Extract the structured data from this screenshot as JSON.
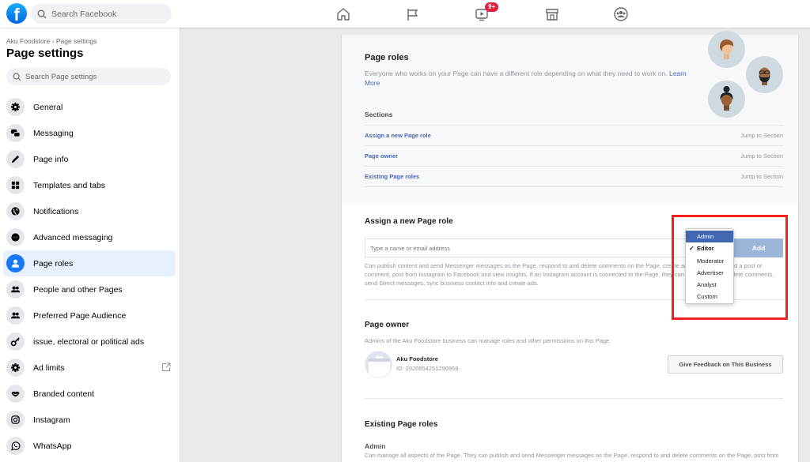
{
  "topbar": {
    "logo": "f",
    "search_placeholder": "Search Facebook",
    "nav": [
      {
        "name": "home",
        "icon": "home-icon"
      },
      {
        "name": "pages",
        "icon": "flag-icon"
      },
      {
        "name": "watch",
        "icon": "video-icon",
        "badge": "9+"
      },
      {
        "name": "marketplace",
        "icon": "store-icon"
      },
      {
        "name": "groups",
        "icon": "groups-icon"
      }
    ]
  },
  "sidebar": {
    "breadcrumb": "Aku Foodstore › Page settings",
    "title": "Page settings",
    "search_placeholder": "Search Page settings",
    "items": [
      {
        "label": "General",
        "icon": "gear-icon"
      },
      {
        "label": "Messaging",
        "icon": "chat-bubbles-icon"
      },
      {
        "label": "Page info",
        "icon": "pencil-icon"
      },
      {
        "label": "Templates and tabs",
        "icon": "grid-icon"
      },
      {
        "label": "Notifications",
        "icon": "globe-icon"
      },
      {
        "label": "Advanced messaging",
        "icon": "messenger-icon"
      },
      {
        "label": "Page roles",
        "icon": "person-icon",
        "active": true
      },
      {
        "label": "People and other Pages",
        "icon": "people-icon"
      },
      {
        "label": "Preferred Page Audience",
        "icon": "people-icon"
      },
      {
        "label": "issue, electoral or political ads",
        "icon": "key-icon"
      },
      {
        "label": "Ad limits",
        "icon": "gear-icon",
        "external": true
      },
      {
        "label": "Branded content",
        "icon": "handshake-icon"
      },
      {
        "label": "Instagram",
        "icon": "instagram-icon"
      },
      {
        "label": "WhatsApp",
        "icon": "whatsapp-icon"
      }
    ]
  },
  "main": {
    "intro": {
      "title": "Page roles",
      "description": "Everyone who works on your Page can have a different role depending on what they need to work on.",
      "learn_more": "Learn More",
      "sections_heading": "Sections",
      "sections": [
        {
          "label": "Assign a new Page role",
          "jump": "Jump to Section"
        },
        {
          "label": "Page owner",
          "jump": "Jump to Section"
        },
        {
          "label": "Existing Page roles",
          "jump": "Jump to Section"
        }
      ]
    },
    "assign": {
      "title": "Assign a new Page role",
      "input_placeholder": "Type a name or email address",
      "input_value": "",
      "selected_role": "Editor",
      "add_label": "Add",
      "role_description": "Can publish content and send Messenger messages as the Page, respond to and delete comments on the Page, create ads, see who created a post or comment, post from Instagram to Facebook and view insights. If an Instagram account is connected to the Page, they can respond to and delete comments, send Direct messages, sync business contact info and create ads.",
      "dropdown_options": [
        {
          "label": "Admin",
          "highlighted": true
        },
        {
          "label": "Editor",
          "checked": true
        },
        {
          "label": "Moderator"
        },
        {
          "label": "Advertiser"
        },
        {
          "label": "Analyst"
        },
        {
          "label": "Custom"
        }
      ]
    },
    "owner": {
      "title": "Page owner",
      "description": "Admins of the Aku Foodstore business can manage roles and other permissions on this Page.",
      "name": "Aku Foodstore",
      "id": "ID: 2920854251296959",
      "feedback_label": "Give Feedback on This Business"
    },
    "existing": {
      "title": "Existing Page roles",
      "role_heading": "Admin",
      "role_description": "Can manage all aspects of the Page. They can publish and send Messenger messages as the Page, respond to and delete comments on the Page, post from Instagram to Facebook, create ads, see who created a post or comment, view insights and assign Page roles."
    }
  },
  "colors": {
    "brand": "#1877f2",
    "link": "#4267b2",
    "highlight": "#f0221b",
    "badge": "#e41e3f"
  }
}
